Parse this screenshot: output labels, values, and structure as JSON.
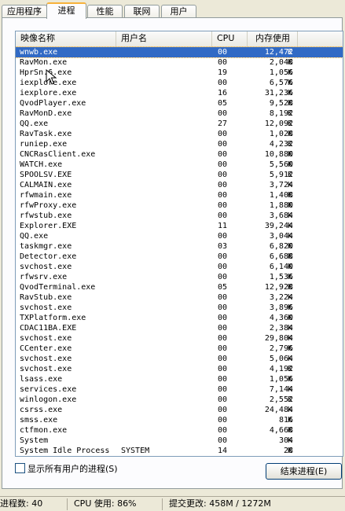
{
  "tabs": [
    "应用程序",
    "进程",
    "性能",
    "联网",
    "用户"
  ],
  "columns": {
    "name": "映像名称",
    "user": "用户名",
    "cpu": "CPU",
    "mem": "内存使用"
  },
  "processes": [
    {
      "name": "wnwb.exe",
      "user": "",
      "cpu": "00",
      "mem": "12,472",
      "unit": "K"
    },
    {
      "name": "RavMon.exe",
      "user": "",
      "cpu": "00",
      "mem": "2,048",
      "unit": "K"
    },
    {
      "name": "HprSn.6.exe",
      "user": "",
      "cpu": "19",
      "mem": "1,056",
      "unit": "K"
    },
    {
      "name": "iexplore.exe",
      "user": "",
      "cpu": "00",
      "mem": "6,576",
      "unit": "K"
    },
    {
      "name": "iexplore.exe",
      "user": "",
      "cpu": "16",
      "mem": "31,236",
      "unit": "K"
    },
    {
      "name": "QvodPlayer.exe",
      "user": "",
      "cpu": "05",
      "mem": "9,528",
      "unit": "K"
    },
    {
      "name": "RavMonD.exe",
      "user": "",
      "cpu": "00",
      "mem": "8,192",
      "unit": "K"
    },
    {
      "name": "QQ.exe",
      "user": "",
      "cpu": "27",
      "mem": "12,092",
      "unit": "K"
    },
    {
      "name": "RavTask.exe",
      "user": "",
      "cpu": "00",
      "mem": "1,028",
      "unit": "K"
    },
    {
      "name": "runiep.exe",
      "user": "",
      "cpu": "00",
      "mem": "4,232",
      "unit": "K"
    },
    {
      "name": "CNCRasClient.exe",
      "user": "",
      "cpu": "00",
      "mem": "10,880",
      "unit": "K"
    },
    {
      "name": "WATCH.exe",
      "user": "",
      "cpu": "00",
      "mem": "5,560",
      "unit": "K"
    },
    {
      "name": "SPOOLSV.EXE",
      "user": "",
      "cpu": "00",
      "mem": "5,912",
      "unit": "K"
    },
    {
      "name": "CALMAIN.exe",
      "user": "",
      "cpu": "00",
      "mem": "3,724",
      "unit": "K"
    },
    {
      "name": "rfwmain.exe",
      "user": "",
      "cpu": "00",
      "mem": "1,408",
      "unit": "K"
    },
    {
      "name": "rfwProxy.exe",
      "user": "",
      "cpu": "00",
      "mem": "1,880",
      "unit": "K"
    },
    {
      "name": "rfwstub.exe",
      "user": "",
      "cpu": "00",
      "mem": "3,684",
      "unit": "K"
    },
    {
      "name": "Explorer.EXE",
      "user": "",
      "cpu": "11",
      "mem": "39,244",
      "unit": "K"
    },
    {
      "name": "QQ.exe",
      "user": "",
      "cpu": "00",
      "mem": "3,044",
      "unit": "K"
    },
    {
      "name": "taskmgr.exe",
      "user": "",
      "cpu": "03",
      "mem": "6,820",
      "unit": "K"
    },
    {
      "name": "Detector.exe",
      "user": "",
      "cpu": "00",
      "mem": "6,688",
      "unit": "K"
    },
    {
      "name": "svchost.exe",
      "user": "",
      "cpu": "00",
      "mem": "6,140",
      "unit": "K"
    },
    {
      "name": "rfwsrv.exe",
      "user": "",
      "cpu": "00",
      "mem": "1,536",
      "unit": "K"
    },
    {
      "name": "QvodTerminal.exe",
      "user": "",
      "cpu": "05",
      "mem": "12,928",
      "unit": "K"
    },
    {
      "name": "RavStub.exe",
      "user": "",
      "cpu": "00",
      "mem": "3,224",
      "unit": "K"
    },
    {
      "name": "svchost.exe",
      "user": "",
      "cpu": "00",
      "mem": "3,896",
      "unit": "K"
    },
    {
      "name": "TXPlatform.exe",
      "user": "",
      "cpu": "00",
      "mem": "4,360",
      "unit": "K"
    },
    {
      "name": "CDAC11BA.EXE",
      "user": "",
      "cpu": "00",
      "mem": "2,384",
      "unit": "K"
    },
    {
      "name": "svchost.exe",
      "user": "",
      "cpu": "00",
      "mem": "29,804",
      "unit": "K"
    },
    {
      "name": "CCenter.exe",
      "user": "",
      "cpu": "00",
      "mem": "2,796",
      "unit": "K"
    },
    {
      "name": "svchost.exe",
      "user": "",
      "cpu": "00",
      "mem": "5,064",
      "unit": "K"
    },
    {
      "name": "svchost.exe",
      "user": "",
      "cpu": "00",
      "mem": "4,192",
      "unit": "K"
    },
    {
      "name": "lsass.exe",
      "user": "",
      "cpu": "00",
      "mem": "1,056",
      "unit": "K"
    },
    {
      "name": "services.exe",
      "user": "",
      "cpu": "00",
      "mem": "7,144",
      "unit": "K"
    },
    {
      "name": "winlogon.exe",
      "user": "",
      "cpu": "00",
      "mem": "2,552",
      "unit": "K"
    },
    {
      "name": "csrss.exe",
      "user": "",
      "cpu": "00",
      "mem": "24,484",
      "unit": "K"
    },
    {
      "name": "smss.exe",
      "user": "",
      "cpu": "00",
      "mem": "816",
      "unit": "K"
    },
    {
      "name": "ctfmon.exe",
      "user": "",
      "cpu": "00",
      "mem": "4,668",
      "unit": "K"
    },
    {
      "name": "System",
      "user": "",
      "cpu": "00",
      "mem": "304",
      "unit": "K"
    },
    {
      "name": "System Idle Process",
      "user": "SYSTEM",
      "cpu": "14",
      "mem": "28",
      "unit": "K"
    }
  ],
  "show_all_label": "显示所有用户的进程(S)",
  "end_process_label": "结束进程(E)",
  "status": {
    "processes": "进程数: 40",
    "cpu": "CPU 使用: 86%",
    "commit": "提交更改: 458M / 1272M"
  },
  "colors": {
    "selection": "#316ac5",
    "tab_highlight": "#f7b23a",
    "background": "#ece9d8"
  }
}
